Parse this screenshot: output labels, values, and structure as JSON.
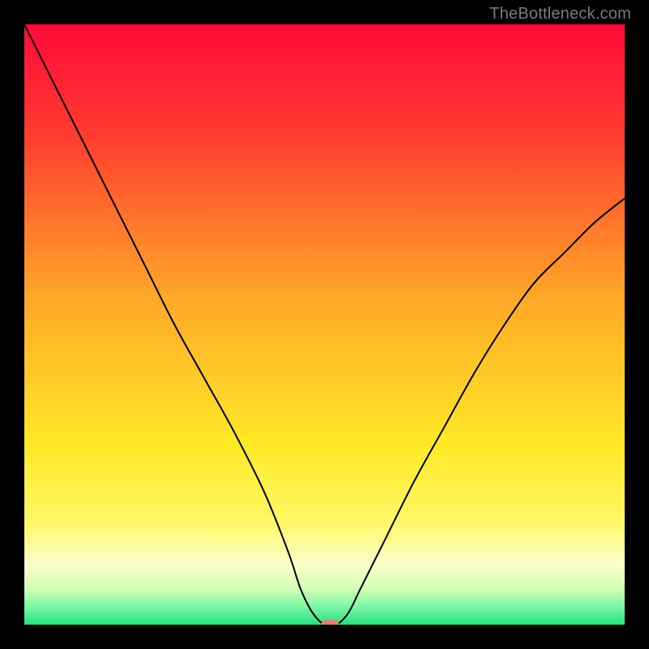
{
  "watermark": "TheBottleneck.com",
  "chart_data": {
    "type": "line",
    "title": "",
    "xlabel": "",
    "ylabel": "",
    "xlim": [
      0,
      100
    ],
    "ylim": [
      0,
      100
    ],
    "grid": false,
    "legend": false,
    "gradient_stops": [
      {
        "pct": 0,
        "color": "#ff0a3a"
      },
      {
        "pct": 18,
        "color": "#ff3a30"
      },
      {
        "pct": 45,
        "color": "#ffa628"
      },
      {
        "pct": 70,
        "color": "#ffe926"
      },
      {
        "pct": 83,
        "color": "#fff867"
      },
      {
        "pct": 90,
        "color": "#fbffcb"
      },
      {
        "pct": 94,
        "color": "#d4ffb6"
      },
      {
        "pct": 97,
        "color": "#7bf7a6"
      },
      {
        "pct": 100,
        "color": "#27e07e"
      }
    ],
    "series": [
      {
        "name": "bottleneck-curve",
        "x": [
          0,
          5,
          10,
          15,
          20,
          25,
          30,
          35,
          40,
          44,
          46,
          48,
          50,
          52,
          54,
          56,
          60,
          65,
          70,
          75,
          80,
          85,
          90,
          95,
          100
        ],
        "y": [
          100,
          90,
          80,
          70,
          60,
          50,
          41,
          32,
          22,
          12,
          6,
          2,
          0,
          0,
          2,
          6,
          14,
          24,
          33,
          42,
          50,
          57,
          62,
          67,
          71
        ]
      }
    ],
    "marker": {
      "x": 51,
      "y": 0,
      "color": "#e08070"
    }
  }
}
